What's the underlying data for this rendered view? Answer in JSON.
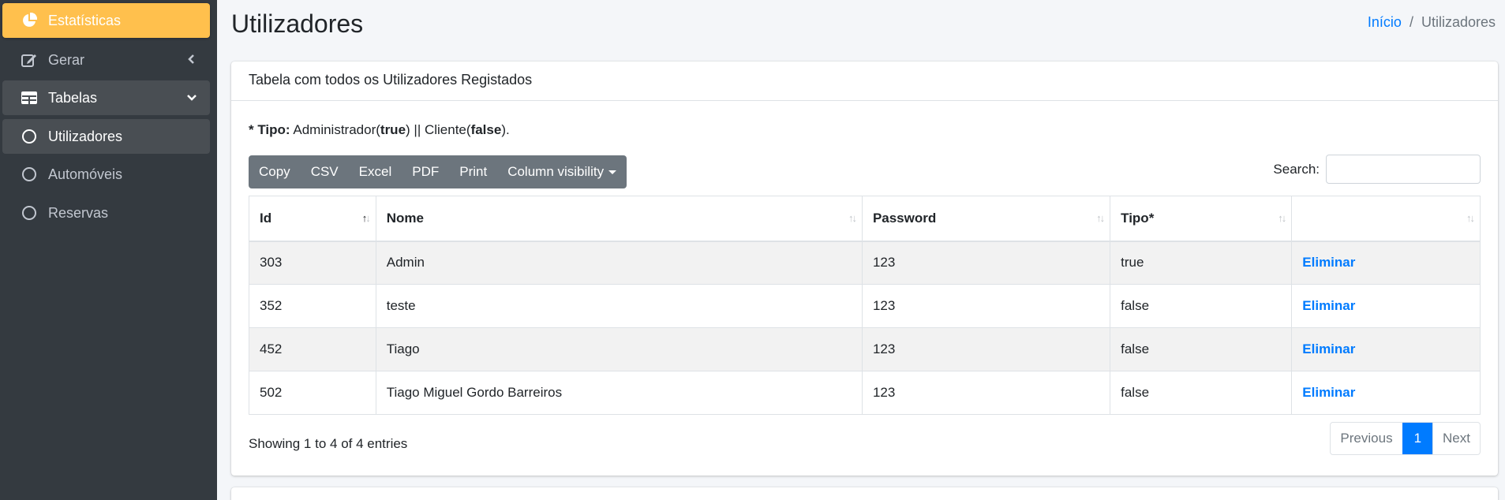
{
  "sidebar": {
    "items": [
      {
        "label": "Estatísticas",
        "icon": "chart-pie-icon"
      },
      {
        "label": "Gerar",
        "icon": "edit-icon"
      },
      {
        "label": "Tabelas",
        "icon": "table-icon"
      },
      {
        "label": "Utilizadores",
        "icon": "circle-icon"
      },
      {
        "label": "Automóveis",
        "icon": "circle-icon"
      },
      {
        "label": "Reservas",
        "icon": "circle-icon"
      }
    ]
  },
  "header": {
    "title": "Utilizadores",
    "breadcrumb": {
      "home": "Início",
      "separator": "/",
      "current": "Utilizadores"
    }
  },
  "card": {
    "title": "Tabela com todos os Utilizadores Registados",
    "note": {
      "label": "* Tipo:",
      "text1": " Administrador(",
      "true": "true",
      "text2": ") || Cliente(",
      "false": "false",
      "text3": ")."
    },
    "buttons": [
      "Copy",
      "CSV",
      "Excel",
      "PDF",
      "Print",
      "Column visibility"
    ],
    "search_label": "Search:",
    "search_value": "",
    "table": {
      "columns": [
        "Id",
        "Nome",
        "Password",
        "Tipo*",
        ""
      ],
      "rows": [
        [
          "303",
          "Admin",
          "123",
          "true",
          "Eliminar"
        ],
        [
          "352",
          "teste",
          "123",
          "false",
          "Eliminar"
        ],
        [
          "452",
          "Tiago",
          "123",
          "false",
          "Eliminar"
        ],
        [
          "502",
          "Tiago Miguel Gordo Barreiros",
          "123",
          "false",
          "Eliminar"
        ]
      ]
    },
    "info": "Showing 1 to 4 of 4 entries",
    "pager": {
      "previous": "Previous",
      "current": "1",
      "next": "Next"
    }
  },
  "colors": {
    "accent": "#ffc04d",
    "link": "#007bff",
    "sidebar": "#343a40"
  }
}
